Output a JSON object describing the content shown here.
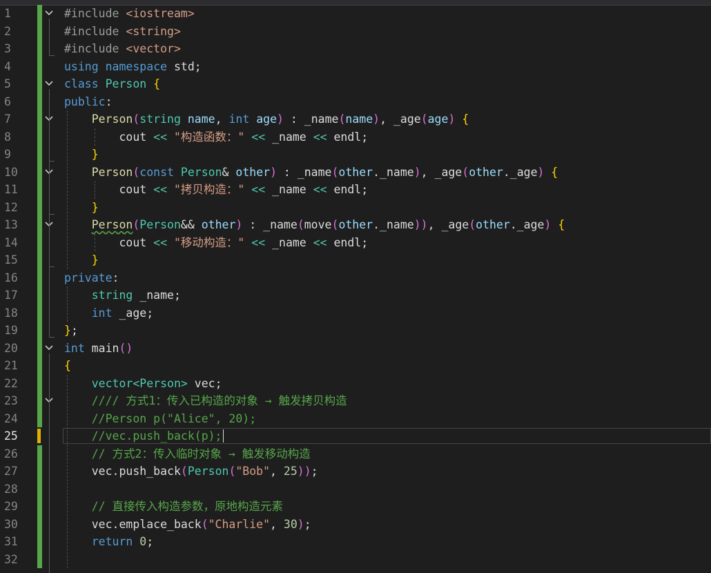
{
  "editor": {
    "current_line": 25,
    "lines": [
      {
        "n": "1",
        "text": "#include <iostream>"
      },
      {
        "n": "2",
        "text": "#include <string>"
      },
      {
        "n": "3",
        "text": "#include <vector>"
      },
      {
        "n": "4",
        "text": "using namespace std;"
      },
      {
        "n": "5",
        "text": "class Person {"
      },
      {
        "n": "6",
        "text": "public:"
      },
      {
        "n": "7",
        "text": "    Person(string name, int age) : _name(name), _age(age) {"
      },
      {
        "n": "8",
        "text": "        cout << \"构造函数：\" << _name << endl;"
      },
      {
        "n": "9",
        "text": "    }"
      },
      {
        "n": "10",
        "text": "    Person(const Person& other) : _name(other._name), _age(other._age) {"
      },
      {
        "n": "11",
        "text": "        cout << \"拷贝构造：\" << _name << endl;"
      },
      {
        "n": "12",
        "text": "    }"
      },
      {
        "n": "13",
        "text": "    Person(Person&& other) : _name(move(other._name)), _age(other._age) {"
      },
      {
        "n": "14",
        "text": "        cout << \"移动构造：\" << _name << endl;"
      },
      {
        "n": "15",
        "text": "    }"
      },
      {
        "n": "16",
        "text": "private:"
      },
      {
        "n": "17",
        "text": "    string _name;"
      },
      {
        "n": "18",
        "text": "    int _age;"
      },
      {
        "n": "19",
        "text": "};"
      },
      {
        "n": "20",
        "text": "int main()"
      },
      {
        "n": "21",
        "text": "{"
      },
      {
        "n": "22",
        "text": "    vector<Person> vec;"
      },
      {
        "n": "23",
        "text": "    //// 方式1：传入已构造的对象 → 触发拷贝构造"
      },
      {
        "n": "24",
        "text": "    //Person p(\"Alice\", 20);"
      },
      {
        "n": "25",
        "text": "    //vec.push_back(p);"
      },
      {
        "n": "26",
        "text": "    // 方式2：传入临时对象 → 触发移动构造"
      },
      {
        "n": "27",
        "text": "    vec.push_back(Person(\"Bob\", 25));"
      },
      {
        "n": "28",
        "text": ""
      },
      {
        "n": "29",
        "text": "    // 直接传入构造参数，原地构造元素"
      },
      {
        "n": "30",
        "text": "    vec.emplace_back(\"Charlie\", 30);"
      },
      {
        "n": "31",
        "text": "    return 0;"
      },
      {
        "n": "32",
        "text": ""
      }
    ],
    "fold_lines": [
      1,
      5,
      7,
      10,
      13,
      20,
      23
    ],
    "colors": {
      "background": "#1e1e1e",
      "keyword": "#569cd6",
      "type": "#4ec9b0",
      "string": "#d69d85",
      "comment": "#57a64a",
      "change_bar": "#57a64a",
      "modified_marker": "#e0b000"
    }
  }
}
